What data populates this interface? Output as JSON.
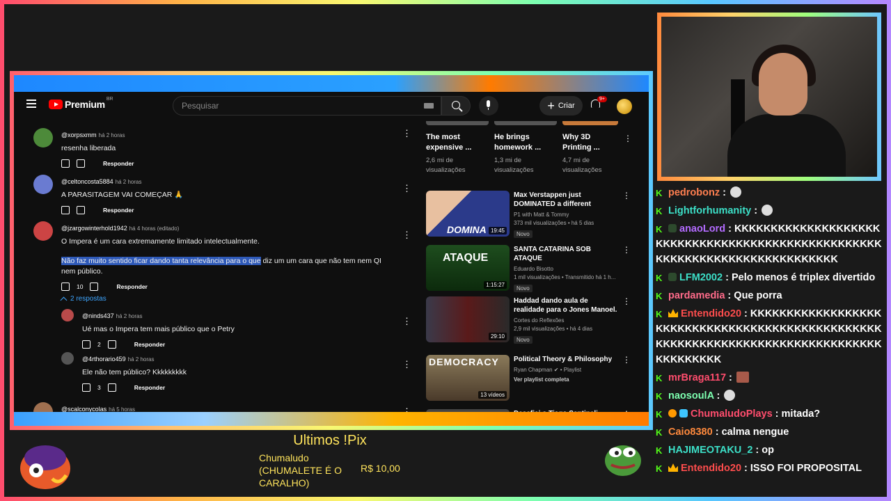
{
  "youtube": {
    "logo_text": "Premium",
    "logo_region": "BR",
    "search_placeholder": "Pesquisar",
    "create_label": "Criar",
    "notif_count": "9+"
  },
  "comments": [
    {
      "user": "@xorpsxmm",
      "time": "há 2 horas",
      "text": "resenha liberada",
      "likes": "",
      "reply": "Responder",
      "avatar_color": "#4d8a3a"
    },
    {
      "user": "@celtoncosta5884",
      "time": "há 2 horas",
      "text": "A PARASITAGEM VAI COMEÇAR 🙏",
      "likes": "",
      "reply": "Responder",
      "avatar_color": "#6a7bd1"
    },
    {
      "user": "@jzargowinterhold1942",
      "time": "há 4 horas (editado)",
      "text1": "O Impera é um cara extremamente limitado intelectualmente.",
      "text2_highlight": "Não faz muito sentido ficar dando tanta relevância para o que",
      "text2_rest": " diz um um cara que não tem nem QI nem público.",
      "likes": "10",
      "reply": "Responder",
      "avatar_color": "#c44"
    }
  ],
  "replies_toggle": "2 respostas",
  "replies": [
    {
      "user": "@ninds437",
      "time": "há 2 horas",
      "text": "Ué mas o Impera tem mais público que o Petry",
      "likes": "2",
      "reply": "Responder",
      "avatar_color": "#b84a4a"
    },
    {
      "user": "@4rthorario459",
      "time": "há 2 horas",
      "text": "Ele não tem público? Kkkkkkkkk",
      "likes": "3",
      "reply": "Responder",
      "avatar_color": "#555"
    }
  ],
  "last_comment": {
    "user": "@scalconycolas",
    "time": "há 5 horas",
    "avatar_color": "#a07050"
  },
  "shorts": [
    {
      "title": "The most expensive ...",
      "views": "2,6 mi de visualizações"
    },
    {
      "title": "He brings homework ...",
      "views": "1,3 mi de visualizações"
    },
    {
      "title": "Why 3D Printing ...",
      "views": "4,7 mi de visualizações"
    }
  ],
  "videos": [
    {
      "title": "Max Verstappen just DOMINATED a different racing...",
      "channel": "P1 with Matt & Tommy",
      "meta": "373 mil visualizações • há 5 dias",
      "badge": "Novo",
      "duration": "19:45",
      "thumb_text": "DOMINA",
      "thumb_bg": "#2b3a8a"
    },
    {
      "title": "SANTA CATARINA SOB ATAQUE",
      "channel": "Eduardo Bisotto",
      "meta": "1 mil visualizações • Transmitido há 1 h...",
      "badge": "Novo",
      "duration": "1:15:27",
      "thumb_text": "ATAQUE",
      "thumb_bg": "#1e4d1e"
    },
    {
      "title": "Haddad dando aula de realidade para o Jones Manoel.",
      "channel": "Cortes do Reflexões",
      "meta": "2,9 mil visualizações • há 4 dias",
      "badge": "Novo",
      "duration": "29:10",
      "thumb_text": "",
      "thumb_bg": "#5a1a1a"
    },
    {
      "title": "Political Theory & Philosophy",
      "channel": "Ryan Chapman ✔ • Playlist",
      "meta": "Ver playlist completa",
      "badge": "",
      "duration": "13 vídeos",
      "thumb_text": "DEMOCRACY",
      "thumb_bg": "#6b5a3a"
    },
    {
      "title": "Desafiei o Tiago Santineli",
      "channel": "",
      "meta": "",
      "badge": "",
      "duration": "",
      "thumb_text": "",
      "thumb_bg": "#444"
    }
  ],
  "chat": [
    {
      "user": "pedrobonz",
      "color": "#ff7f50",
      "text": "",
      "emote": true
    },
    {
      "user": "Lightforhumanity",
      "color": "#3ce0c8",
      "text": "",
      "emote": true
    },
    {
      "user": "anaoLord",
      "color": "#b36bff",
      "text": "KKKKKKKKKKKKKKKKKKKKKKKKKKKKKKKKKKKKKKKKKKKKKKKKKKKKKKKKKKKKKKKKKKKKKKKKKKKK",
      "emote": false
    },
    {
      "user": "LFM2002",
      "color": "#3ce0c8",
      "text": "Pelo menos é triplex divertido",
      "emote": false
    },
    {
      "user": "pardamedia",
      "color": "#ff6b8a",
      "text": "Que porra",
      "emote": false
    },
    {
      "user": "Entendido20",
      "color": "#ff4d4d",
      "text": "KKKKKKKKKKKKKKKKKKKKKKKKKKKKKKKKKKKKKKKKKKKKKKKKKKKKKKKKKKKKKKKKKKKKKKKKKKKKKKKKKKKKKKKKK",
      "emote": false
    },
    {
      "user": "mrBraga117",
      "color": "#ff4d6d",
      "text": "",
      "emote": true
    },
    {
      "user": "naosoulA",
      "color": "#7dffb0",
      "text": "",
      "emote": true
    },
    {
      "user": "ChumaludoPlays",
      "color": "#ff4d6d",
      "text": "mitada?",
      "emote": false
    },
    {
      "user": "Caio8380",
      "color": "#ff8a3d",
      "text": "calma nengue",
      "emote": false
    },
    {
      "user": "HAJIMEOTAKU_2",
      "color": "#3ce0c8",
      "text": "op",
      "emote": false
    },
    {
      "user": "Entendido20",
      "color": "#ff4d4d",
      "text": "ISSO FOI PROPOSITAL",
      "emote": false
    }
  ],
  "pix": {
    "title": "Ultimos !Pix",
    "donor": "Chumaludo (CHUMALETE É O CARALHO)",
    "amount": "R$ 10,00"
  }
}
